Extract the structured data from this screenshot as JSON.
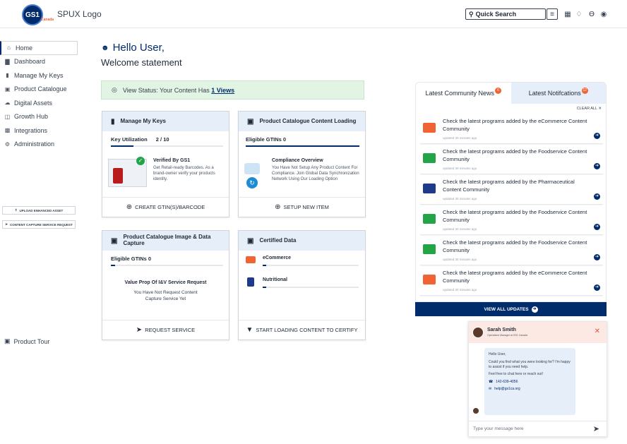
{
  "header": {
    "logo_text": "GS1",
    "logo_sub": "Canada",
    "app_title": "SPUX Logo",
    "search_label": "Quick Search",
    "icons": [
      "search-icon",
      "filter-icon",
      "grid-icon",
      "bell-icon",
      "cart-icon",
      "user-icon"
    ]
  },
  "sidebar": {
    "items": [
      {
        "label": "Home",
        "icon": "home-icon",
        "active": true
      },
      {
        "label": "Dashboard",
        "icon": "chart-icon"
      },
      {
        "label": "Manage My Keys",
        "icon": "barcode-icon"
      },
      {
        "label": "Product Catalogue",
        "icon": "box-icon"
      },
      {
        "label": "Digital Assets",
        "icon": "cloud-icon"
      },
      {
        "label": "Growth Hub",
        "icon": "growth-icon"
      },
      {
        "label": "Integrations",
        "icon": "integration-icon"
      },
      {
        "label": "Administration",
        "icon": "gear-icon"
      }
    ],
    "upload_button": "UPLOAD ENHANCED ASSET",
    "capture_button": "CONTENT CAPTURE SERVICE REQUEST",
    "tour_label": "Product Tour"
  },
  "greeting": {
    "hello": "Hello User,",
    "welcome": "Welcome statement"
  },
  "status": {
    "text": "View Status: Your Content Has ",
    "link": "1 Views"
  },
  "cards": {
    "keys": {
      "title": "Manage My Keys",
      "metric_label": "Key Utilization",
      "metric_value": "2 / 10",
      "progress": 0.2,
      "feature_title": "Verified By GS1",
      "feature_text": "Get Retail-ready Barcodes. As a brand-owner verify your products identity.",
      "action": "CREATE GTIN(S)/BARCODE"
    },
    "catalogue": {
      "title": "Product Catalogue Content Loading",
      "metric_label": "Eligible GTINs 0",
      "progress": 1.0,
      "feature_title": "Compliance Overview",
      "feature_text": "You Have Not Setup Any Product Content For Compliance. Join Global Data Synchronization Network Using Our Loading Option",
      "action": "SETUP NEW ITEM"
    },
    "image": {
      "title": "Product Catalogue Image & Data Capture",
      "metric_label": "Eligible GTINs 0",
      "progress": 0.04,
      "feature_title": "Value Prop Of I&V Service Request",
      "feature_text": "You Have Not Request Content Capture Service Yet",
      "action": "REQUEST SERVICE"
    },
    "certified": {
      "title": "Certified Data",
      "rows": [
        {
          "label": "eCommerce",
          "progress": 0.04
        },
        {
          "label": "Nutritional",
          "progress": 0.04
        }
      ],
      "action": "START LOADING CONTENT TO CERTIFY"
    }
  },
  "news": {
    "tab_community": "Latest Community News",
    "tab_community_count": "6",
    "tab_notifications": "Latest Notifcations",
    "tab_notifications_count": "12",
    "clear_all": "CLEAR ALL ✕",
    "items": [
      {
        "text": "Check the latest programs added by the eCommerce Content Community",
        "time": "updated 30 minutes ago",
        "color": "#f26334"
      },
      {
        "text": "Check the latest programs added by the Foodservice Content Community",
        "time": "updated 30 minutes ago",
        "color": "#22a447"
      },
      {
        "text": "Check the latest programs added by the Pharmaceutical Content Community",
        "time": "updated 30 minutes ago",
        "color": "#1e3a8a"
      },
      {
        "text": "Check the latest programs added by the Foodservice Content Community",
        "time": "updated 30 minutes ago",
        "color": "#22a447"
      },
      {
        "text": "Check the latest programs added by the Foodservice Content Community",
        "time": "updated 30 minutes ago",
        "color": "#22a447"
      },
      {
        "text": "Check the latest programs added by the eCommerce Content Community",
        "time": "updated 30 minutes ago",
        "color": "#f26334"
      }
    ],
    "view_all": "VIEW ALL UPDATES"
  },
  "chat": {
    "name": "Sarah Smith",
    "role": "Operations Manager at GS1 Canada",
    "greeting": "Hello User,",
    "message": "Could you find what you were looking for? I'm happy to assist if you need help.",
    "followup": "Feel free to chat here or reach out!",
    "phone": "142-639-4056",
    "email": "help@gs1ca.org",
    "placeholder": "Type your message here"
  },
  "colors": {
    "primary": "#002c6c",
    "accent": "#f26334",
    "card_header": "#e6eef9",
    "status_bg": "#e2f4e4"
  }
}
